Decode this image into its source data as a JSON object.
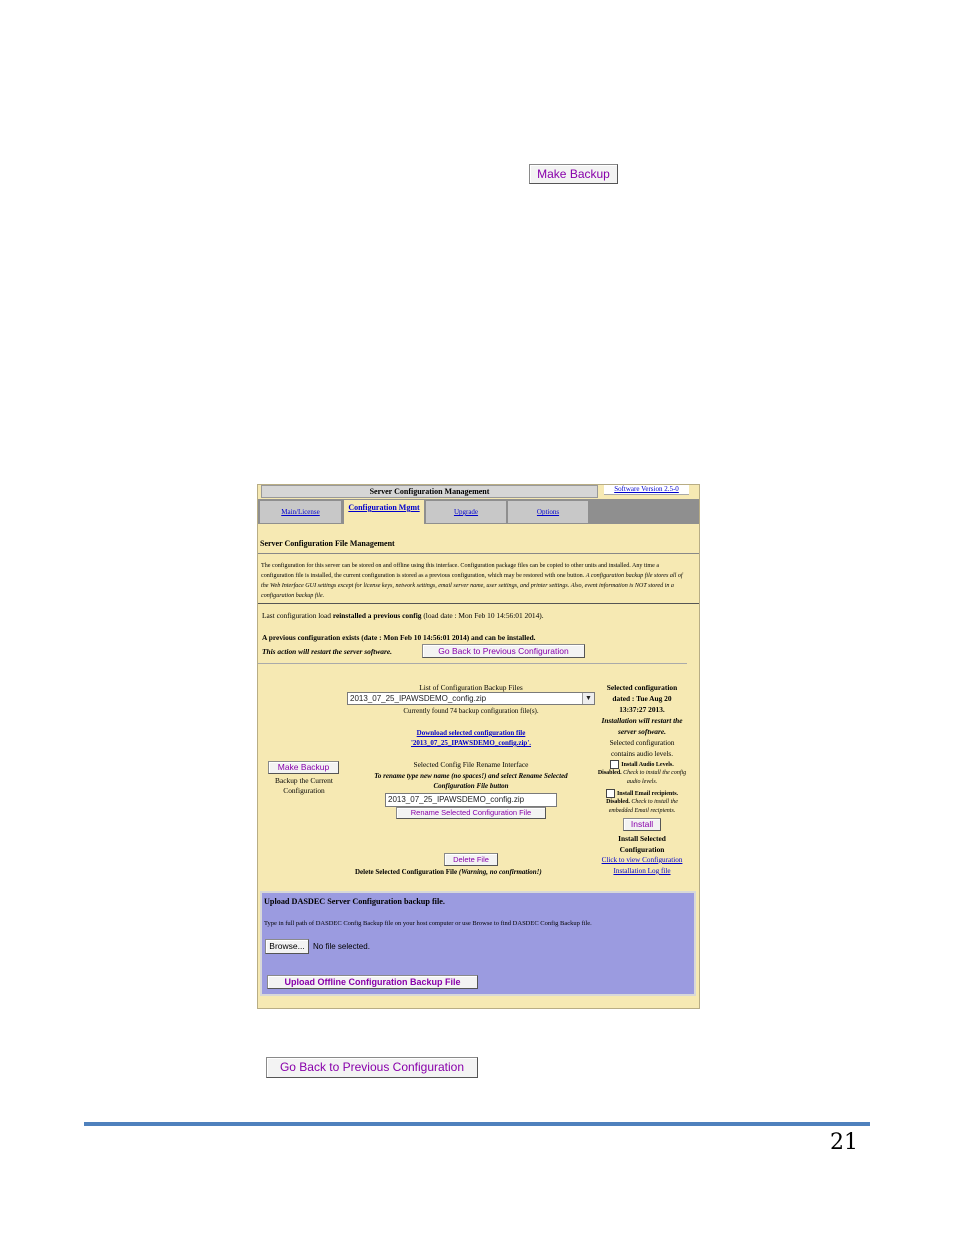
{
  "doc": {
    "make_backup_label": "Make Backup",
    "go_back_label": "Go Back to Previous Configuration",
    "page_number": "21",
    "rule_color": "#4f81bd"
  },
  "screenshot": {
    "header": {
      "title": "Server Configuration Management",
      "version": "Software Version 2.5-0"
    },
    "tabs": [
      {
        "label": "Main/License",
        "active": false
      },
      {
        "label": "Configuration Mgmt",
        "active": true
      },
      {
        "label": "Upgrade",
        "active": false
      },
      {
        "label": "Options",
        "active": false
      }
    ],
    "section_title": "Server Configuration File Management",
    "intro_plain": "The configuration for this server can be stored on and offline using this interface. Configuration package files can be copied to other units and installed. Any time a configuration file is installed, the current configuration is stored as a previous configuration, which may be restored with one button.",
    "intro_italic": "A configuration backup file stores all of the Web Interface GUI settings except for license keys, network settings, email server name, user settings, and printer settings. Also, event information is NOT stored in a configuration backup file.",
    "last_load": {
      "prefix": "Last configuration load",
      "bold": "reinstalled a previous config",
      "suffix": "(load date : Mon Feb 10 14:56:01 2014)."
    },
    "previous_exists": "A previous configuration exists (date : Mon Feb 10 14:56:01 2014) and can be installed.",
    "restart_warning": "This action will restart the server software.",
    "go_back_label": "Go Back to Previous Configuration",
    "left": {
      "make_backup_label": "Make Backup",
      "caption": "Backup the Current Configuration"
    },
    "middle": {
      "list_title": "List of Configuration Backup Files",
      "selected_file": "2013_07_25_IPAWSDEMO_config.zip",
      "found_text": "Currently found 74 backup configuration file(s).",
      "download_link_1": "Download selected configuration file",
      "download_link_2": "'2013_07_25_IPAWSDEMO_config.zip'.",
      "rename_title": "Selected Config File Rename Interface",
      "rename_instructions": "To rename type new name (no spaces!) and select Rename Selected Configuration File button",
      "rename_value": "2013_07_25_IPAWSDEMO_config.zip",
      "rename_button": "Rename Selected Configuration File",
      "delete_button": "Delete File",
      "delete_caption": "Delete Selected Configuration File",
      "delete_warning": "(Warning, no confirmation!)"
    },
    "right": {
      "selected_dated": "Selected configuration dated : Tue Aug 20 13:37:27 2013.",
      "install_restart": "Installation will restart the server software.",
      "contains_audio": "Selected configuration contains audio levels.",
      "install_audio_label": "Install Audio Levels.",
      "install_audio_note_bold": "Disabled.",
      "install_audio_note": "Check to install the config audio levels.",
      "install_email_label": "Install Email recipients.",
      "install_email_note_bold": "Disabled.",
      "install_email_note": "Check to install the embedded Email recipients.",
      "install_button": "Install",
      "install_caption": "Install Selected Configuration",
      "log_link": "Click to view Configuration Installation Log file"
    },
    "upload": {
      "title": "Upload DASDEC Server Configuration backup file.",
      "instructions": "Type in full path of DASDEC Config Backup file on your host computer or use Browse to find DASDEC Config Backup file.",
      "browse_label": "Browse...",
      "no_file": "No file selected.",
      "upload_button": "Upload Offline Configuration Backup File"
    }
  }
}
